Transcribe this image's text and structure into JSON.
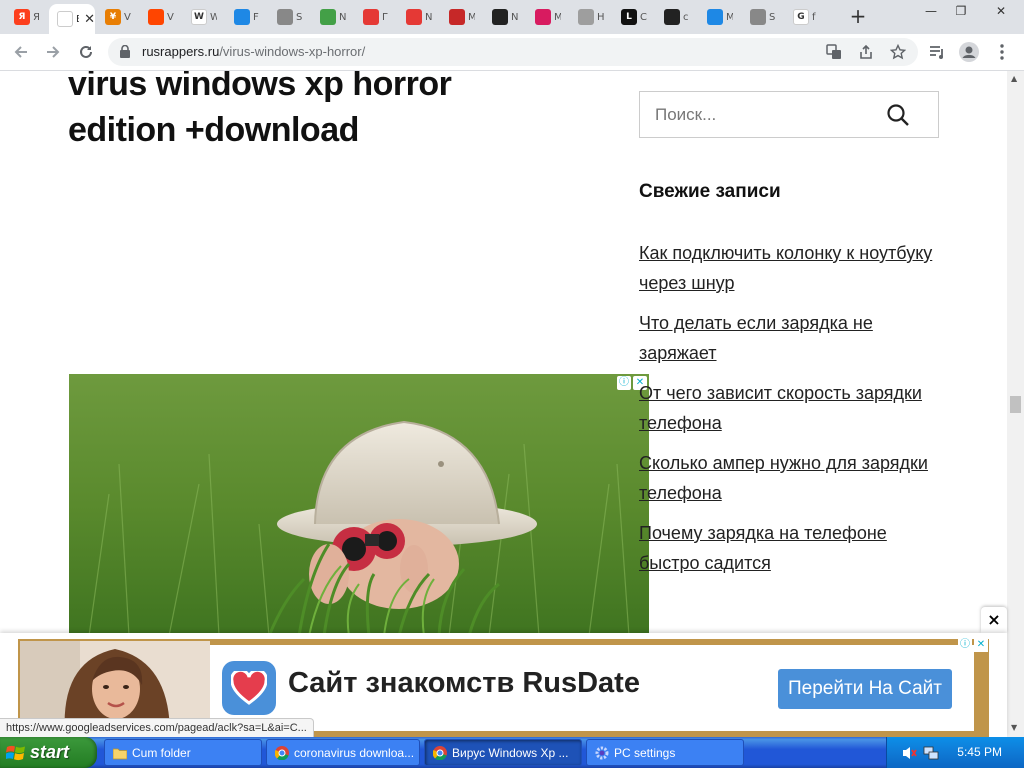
{
  "browser": {
    "tabs": [
      {
        "title": "Я",
        "fav_char": "Я",
        "color": "#fc3f1d"
      },
      {
        "title": "Ви",
        "fav_char": "",
        "color": "#ffffff",
        "active": true
      },
      {
        "title": "V",
        "fav_char": "¥",
        "color": "#e87e04"
      },
      {
        "title": "V",
        "fav_char": "",
        "color": "#ff4500"
      },
      {
        "title": "W",
        "fav_char": "W",
        "color": "#ffffff"
      },
      {
        "title": "F",
        "fav_char": "",
        "color": "#1e88e5"
      },
      {
        "title": "S",
        "fav_char": "",
        "color": "#888888"
      },
      {
        "title": "N",
        "fav_char": "",
        "color": "#43a047"
      },
      {
        "title": "Г",
        "fav_char": "",
        "color": "#e53935"
      },
      {
        "title": "N",
        "fav_char": "",
        "color": "#e53935"
      },
      {
        "title": "M",
        "fav_char": "",
        "color": "#c62828"
      },
      {
        "title": "N",
        "fav_char": "",
        "color": "#222222"
      },
      {
        "title": "M",
        "fav_char": "",
        "color": "#d81b60"
      },
      {
        "title": "H",
        "fav_char": "",
        "color": "#9e9e9e"
      },
      {
        "title": "C",
        "fav_char": "L",
        "color": "#111111"
      },
      {
        "title": "c",
        "fav_char": "",
        "color": "#222222"
      },
      {
        "title": "M",
        "fav_char": "",
        "color": "#1e88e5"
      },
      {
        "title": "S",
        "fav_char": "",
        "color": "#888888"
      },
      {
        "title": "f",
        "fav_char": "G",
        "color": "#ffffff"
      }
    ],
    "new_tab_label": "+",
    "window_controls": {
      "minimize": "—",
      "restore": "❐",
      "close": "✕"
    },
    "url_domain": "rusrappers.ru",
    "url_path": "/virus-windows-xp-horror/"
  },
  "page": {
    "title": "virus windows xp horror edition +download",
    "search_placeholder": "Поиск...",
    "recent_heading": "Свежие записи",
    "recent_posts": [
      "Как подключить колонку к ноутбуку через шнур",
      "Что делать если зарядка не заряжает",
      "От чего зависит скорость зарядки телефона",
      "Сколько ампер нужно для зарядки телефона",
      "Почему зарядка на телефоне быстро садится"
    ],
    "ad_choice_i": "ⓘ",
    "ad_choice_x": "✕"
  },
  "banner_ad": {
    "close_label": "×",
    "headline": "Сайт знакомств RusDate",
    "cta": "Перейти На Сайт",
    "accent": "#4a90d9"
  },
  "status_url": "https://www.googleadservices.com/pagead/aclk?sa=L&ai=C...",
  "taskbar": {
    "start_label": "start",
    "tasks": [
      {
        "label": "Cum folder",
        "icon": "folder-icon"
      },
      {
        "label": "coronavirus downloa...",
        "icon": "chrome-icon"
      },
      {
        "label": "Вирус Windows Xp ...",
        "icon": "chrome-icon",
        "active": true
      },
      {
        "label": "PC settings",
        "icon": "gear-icon"
      }
    ],
    "clock": "5:45 PM"
  }
}
